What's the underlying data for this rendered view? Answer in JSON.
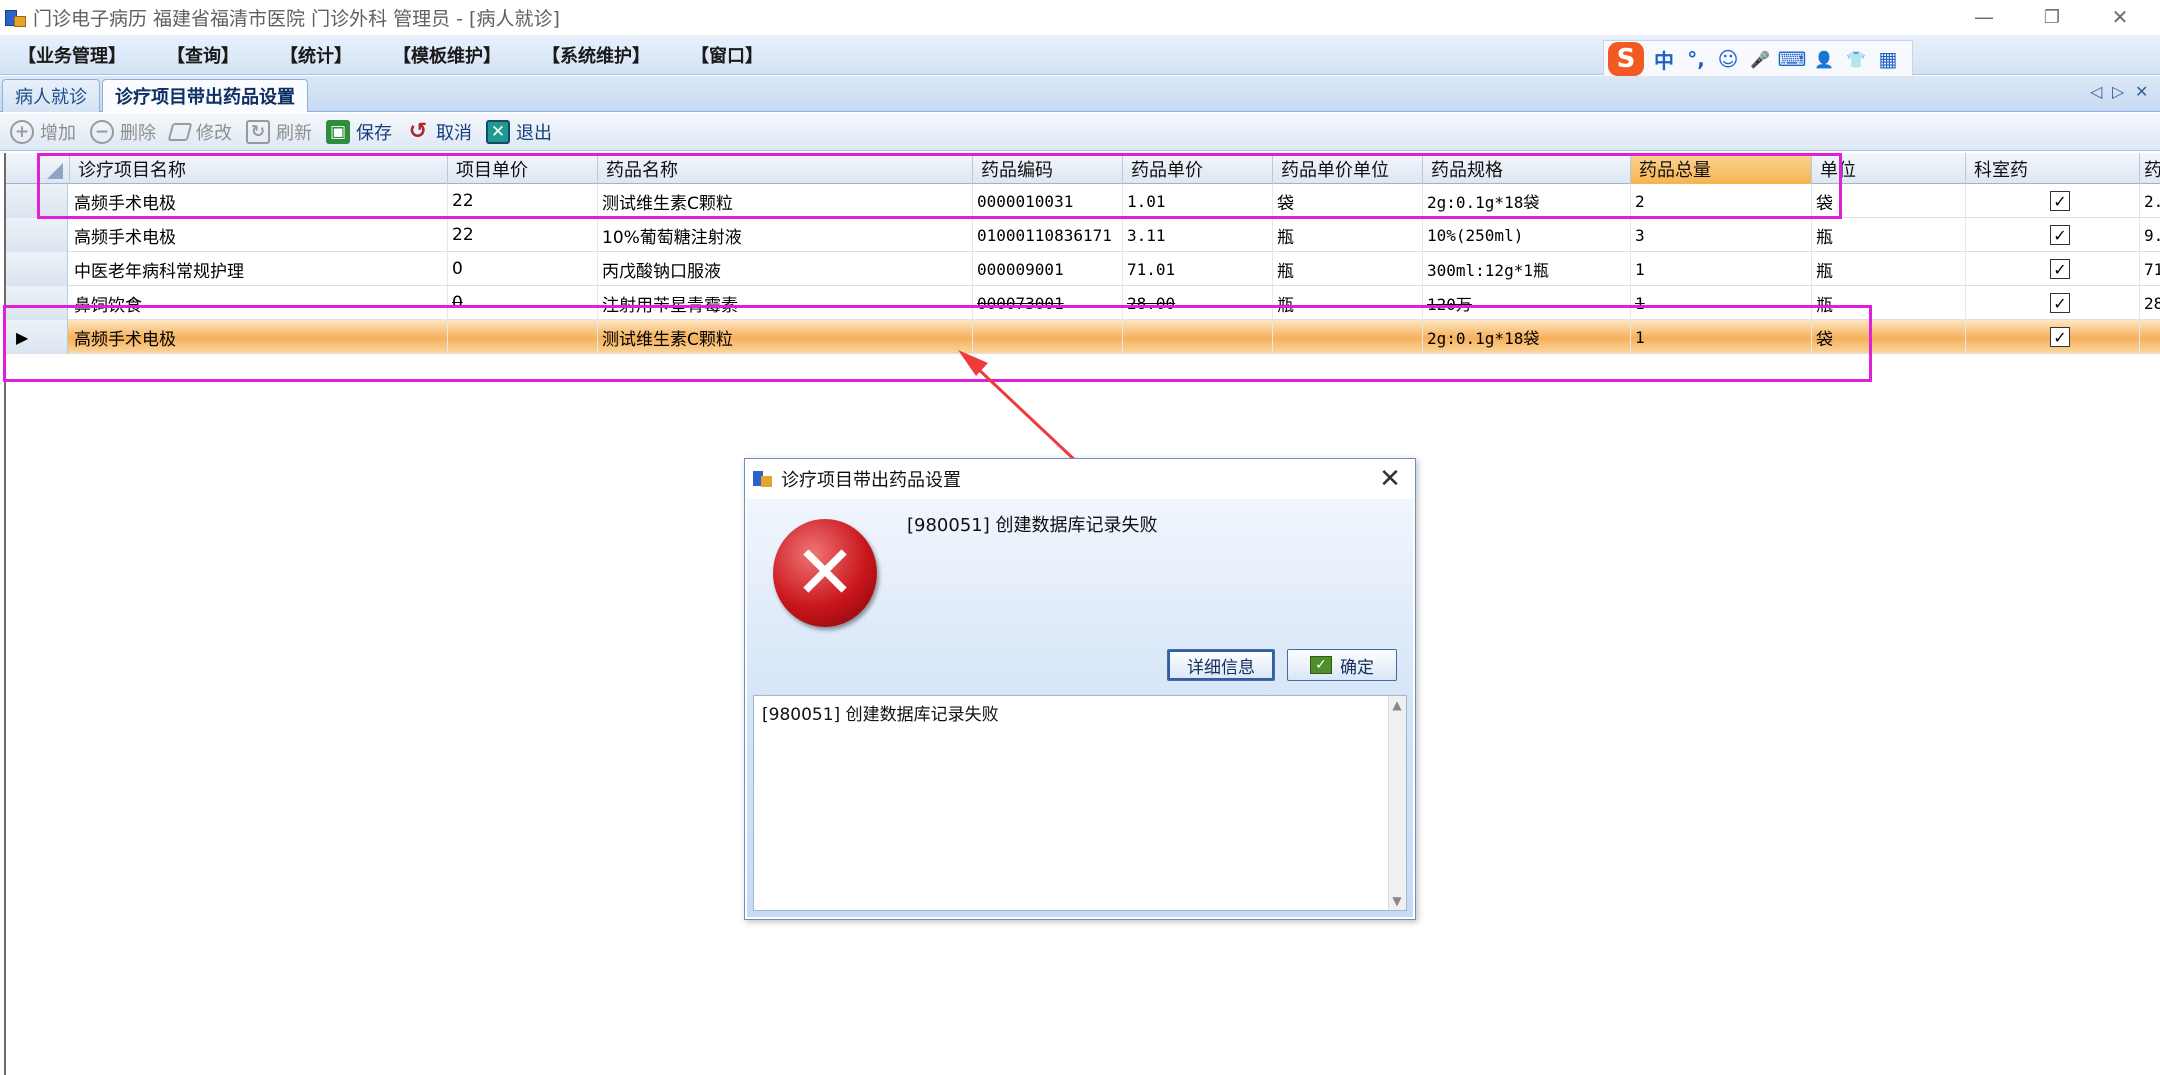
{
  "window": {
    "title": "门诊电子病历  福建省福清市医院  门诊外科  管理员 - [病人就诊]",
    "minimize": "—",
    "restore": "❐",
    "close": "✕"
  },
  "menu": {
    "items": [
      "【业务管理】",
      "【查询】",
      "【统计】",
      "【模板维护】",
      "【系统维护】",
      "【窗口】"
    ]
  },
  "ime": {
    "logo": "S",
    "items": [
      "中",
      "°,",
      "☺",
      "🎤",
      "⌨",
      "👤",
      "👕",
      "▦"
    ]
  },
  "tabs": {
    "items": [
      "病人就诊",
      "诊疗项目带出药品设置"
    ],
    "nav_prev": "◁",
    "nav_next": "▷",
    "nav_close": "✕"
  },
  "toolbar": {
    "add": "增加",
    "delete": "删除",
    "edit": "修改",
    "refresh": "刷新",
    "save": "保存",
    "cancel": "取消",
    "exit": "退出"
  },
  "grid": {
    "columns": [
      "诊疗项目名称",
      "项目单价",
      "药品名称",
      "药品编码",
      "药品单价",
      "药品单价单位",
      "药品规格",
      "药品总量",
      "单位",
      "科室药",
      "药"
    ],
    "rows": [
      {
        "name": "高频手术电极",
        "price": "22",
        "drug": "测试维生素C颗粒",
        "code": "0000010031",
        "drug_price": "1.01",
        "drug_unit": "袋",
        "spec": "2g:0.1g*18袋",
        "qty": "2",
        "unit": "袋",
        "dept": "✓",
        "last": "2."
      },
      {
        "name": "高频手术电极",
        "price": "22",
        "drug": "10%葡萄糖注射液",
        "code": "01000110836171",
        "drug_price": "3.11",
        "drug_unit": "瓶",
        "spec": "10%(250ml)",
        "qty": "3",
        "unit": "瓶",
        "dept": "✓",
        "last": "9."
      },
      {
        "name": "中医老年病科常规护理",
        "price": "0",
        "drug": "丙戊酸钠口服液",
        "code": "000009001",
        "drug_price": "71.01",
        "drug_unit": "瓶",
        "spec": "300ml:12g*1瓶",
        "qty": "1",
        "unit": "瓶",
        "dept": "✓",
        "last": "71"
      },
      {
        "name": "鼻饲饮食",
        "price": "0",
        "drug": "注射用苄星青霉素",
        "code": "000073001",
        "drug_price": "28.00",
        "drug_unit": "瓶",
        "spec": "120万",
        "qty": "1",
        "unit": "瓶",
        "dept": "✓",
        "last": "28"
      },
      {
        "marker": "▶",
        "name": "高频手术电极",
        "price": "",
        "drug": "测试维生素C颗粒",
        "code": "",
        "drug_price": "",
        "drug_unit": "",
        "spec": "2g:0.1g*18袋",
        "qty": "1",
        "unit": "袋",
        "dept": "✓",
        "last": ""
      }
    ]
  },
  "dialog": {
    "title": "诊疗项目带出药品设置",
    "close": "✕",
    "message": "[980051] 创建数据库记录失败",
    "details_button": "详细信息",
    "ok_button": "确定",
    "detail_text": "[980051] 创建数据库记录失败",
    "error_icon": "✕",
    "ok_icon": "✓"
  },
  "colors": {
    "annotation": "#e020d8",
    "arrow": "#ee3b3b",
    "selected_row": "#f6b05a"
  }
}
